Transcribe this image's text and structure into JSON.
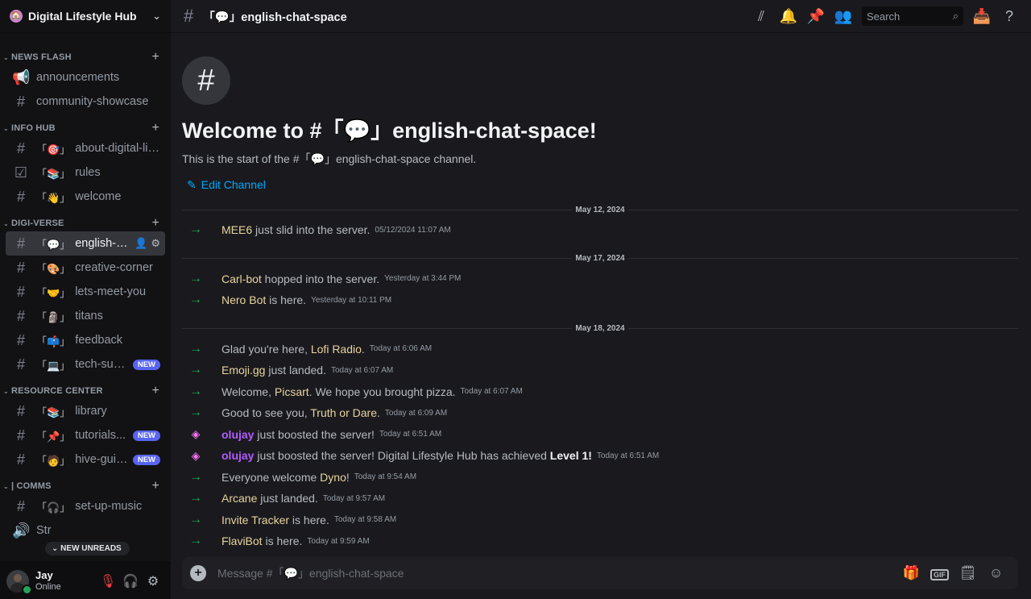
{
  "server": {
    "name": "Digital Lifestyle Hub",
    "icon": "🏠"
  },
  "categories": [
    {
      "label": "NEWS FLASH",
      "channels": [
        {
          "icon": "📢",
          "emoji": "",
          "name": "announcements",
          "badge": ""
        },
        {
          "icon": "#",
          "emoji": "",
          "name": "community-showcase",
          "badge": ""
        }
      ]
    },
    {
      "label": "INFO HUB",
      "channels": [
        {
          "icon": "#",
          "emoji": "「🎯」",
          "name": "about-digital-lif...",
          "badge": ""
        },
        {
          "icon": "☑",
          "emoji": "「📚」",
          "name": "rules",
          "badge": ""
        },
        {
          "icon": "#",
          "emoji": "「👋」",
          "name": "welcome",
          "badge": ""
        }
      ]
    },
    {
      "label": "DIGI-VERSE",
      "channels": [
        {
          "icon": "#",
          "emoji": "「💬」",
          "name": "english-ch...",
          "badge": "",
          "active": true
        },
        {
          "icon": "#",
          "emoji": "「🎨」",
          "name": "creative-corner",
          "badge": ""
        },
        {
          "icon": "#",
          "emoji": "「🤝」",
          "name": "lets-meet-you",
          "badge": ""
        },
        {
          "icon": "#",
          "emoji": "「🗿」",
          "name": "titans",
          "badge": ""
        },
        {
          "icon": "#",
          "emoji": "「📫」",
          "name": "feedback",
          "badge": ""
        },
        {
          "icon": "#",
          "emoji": "「💻」",
          "name": "tech-sup...",
          "badge": "NEW"
        }
      ]
    },
    {
      "label": "RESOURCE CENTER",
      "channels": [
        {
          "icon": "#",
          "emoji": "「📚」",
          "name": "library",
          "badge": ""
        },
        {
          "icon": "#",
          "emoji": "「📌」",
          "name": "tutorials...",
          "badge": "NEW"
        },
        {
          "icon": "#",
          "emoji": "「🧑」",
          "name": "hive-guid...",
          "badge": "NEW"
        }
      ]
    },
    {
      "label": "| COMMS",
      "channels": [
        {
          "icon": "#",
          "emoji": "「🎧」",
          "name": "set-up-music",
          "badge": ""
        },
        {
          "icon": "🔊",
          "emoji": "",
          "name": "Str",
          "badge": ""
        }
      ]
    }
  ],
  "new_unreads": "NEW UNREADS",
  "user": {
    "name": "Jay",
    "status": "Online"
  },
  "topbar": {
    "channel": "「💬」english-chat-space",
    "search_placeholder": "Search"
  },
  "welcome": {
    "title": "Welcome to #「💬」english-chat-space!",
    "subtitle": "This is the start of the #「💬」english-chat-space channel.",
    "edit": "Edit Channel"
  },
  "groups": [
    {
      "date": "May 12, 2024",
      "messages": [
        {
          "kind": "join",
          "pre": "",
          "name": "MEE6",
          "post": " just slid into the server.",
          "time": "05/12/2024 11:07 AM"
        }
      ]
    },
    {
      "date": "May 17, 2024",
      "messages": [
        {
          "kind": "join",
          "pre": "",
          "name": "Carl-bot",
          "post": " hopped into the server.",
          "time": "Yesterday at 3:44 PM"
        },
        {
          "kind": "join",
          "pre": "",
          "name": "Nero Bot",
          "post": " is here.",
          "time": "Yesterday at 10:11 PM"
        }
      ]
    },
    {
      "date": "May 18, 2024",
      "messages": [
        {
          "kind": "join",
          "pre": "Glad you're here, ",
          "name": "Lofi Radio",
          "post": ".",
          "time": "Today at 6:06 AM"
        },
        {
          "kind": "join",
          "pre": "",
          "name": "Emoji.gg",
          "post": " just landed.",
          "time": "Today at 6:07 AM"
        },
        {
          "kind": "join",
          "pre": "Welcome, ",
          "name": "Picsart",
          "post": ". We hope you brought pizza.",
          "time": "Today at 6:07 AM"
        },
        {
          "kind": "join",
          "pre": "Good to see you, ",
          "name": "Truth or Dare",
          "post": ".",
          "time": "Today at 6:09 AM"
        },
        {
          "kind": "boost",
          "pre": "",
          "name": "olujay",
          "post": " just boosted the server!",
          "time": "Today at 6:51 AM"
        },
        {
          "kind": "boost",
          "pre": "",
          "name": "olujay",
          "post": " just boosted the server! Digital Lifestyle Hub has achieved ",
          "bold": "Level 1!",
          "time": "Today at 6:51 AM"
        },
        {
          "kind": "join",
          "pre": "Everyone welcome ",
          "name": "Dyno",
          "post": "!",
          "time": "Today at 9:54 AM"
        },
        {
          "kind": "join",
          "pre": "",
          "name": "Arcane",
          "post": " just landed.",
          "time": "Today at 9:57 AM"
        },
        {
          "kind": "join",
          "pre": "",
          "name": "Invite Tracker",
          "post": " is here.",
          "time": "Today at 9:58 AM"
        },
        {
          "kind": "join",
          "pre": "",
          "name": "FlaviBot",
          "post": " is here.",
          "time": "Today at 9:59 AM"
        }
      ]
    }
  ],
  "composer": {
    "placeholder": "Message #「💬」english-chat-space",
    "gif_label": "GIF"
  },
  "icons": {
    "threads": "threads-icon",
    "bell": "bell-icon",
    "pin": "pin-icon",
    "members": "members-icon",
    "search": "search-icon",
    "inbox": "inbox-icon",
    "help": "help-icon",
    "gift": "gift-icon",
    "sticker": "sticker-icon",
    "emoji": "emoji-icon"
  },
  "colors": {
    "accent": "#5865f2",
    "join_arrow": "#23a55a",
    "boost": "#ff73fa",
    "link": "#00a8fc"
  }
}
